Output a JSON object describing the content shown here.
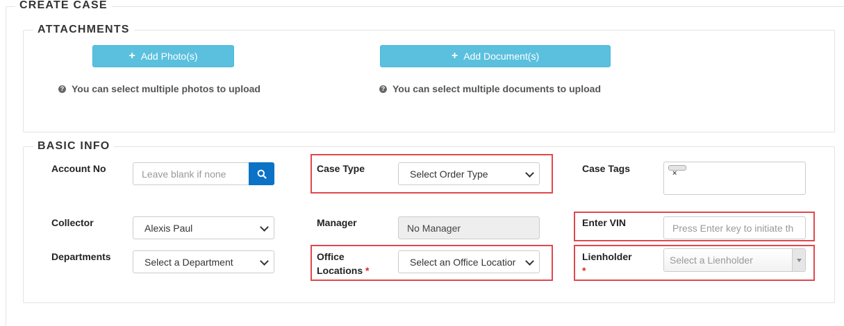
{
  "page": {
    "create_case_title": "CREATE CASE"
  },
  "attachments": {
    "title": "ATTACHMENTS",
    "add_photos_label": "Add Photo(s)",
    "add_documents_label": "Add Document(s)",
    "photos_hint": "You can select multiple photos to upload",
    "documents_hint": "You can select multiple documents to upload"
  },
  "basic_info": {
    "title": "BASIC INFO",
    "account_no_label": "Account No",
    "account_no_placeholder": "Leave blank if none",
    "case_type_label": "Case Type",
    "case_type_value": "Select Order Type",
    "case_tags_label": "Case Tags",
    "collector_label": "Collector",
    "collector_value": "Alexis Paul",
    "manager_label": "Manager",
    "manager_value": "No Manager",
    "enter_vin_label": "Enter VIN",
    "enter_vin_placeholder": "Press Enter key to initiate th",
    "departments_label": "Departments",
    "departments_value": "Select a Department",
    "office_locations_label_line1": "Office",
    "office_locations_label_line2": "Locations",
    "office_locations_value": "Select an Office Locatior",
    "lienholder_label": "Lienholder",
    "lienholder_value": "Select a Lienholder",
    "required_mark": "*"
  },
  "icons": {
    "plus": "plus-icon",
    "question": "question-circle-icon",
    "search": "search-icon",
    "chevron": "chevron-down-icon",
    "tag_remove": "close-icon"
  },
  "colors": {
    "button_info": "#5bc0de",
    "search_button": "#0b72c6",
    "highlight_box": "#e0474c",
    "required": "#e2231a"
  }
}
